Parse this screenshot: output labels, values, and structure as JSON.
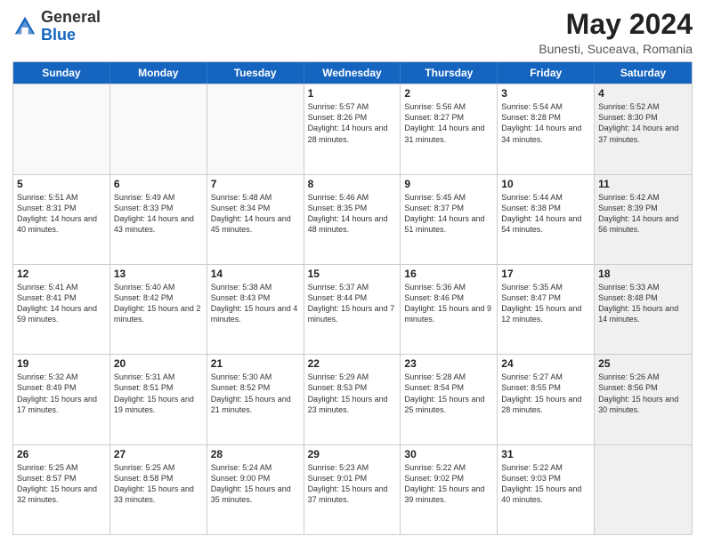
{
  "header": {
    "logo_general": "General",
    "logo_blue": "Blue",
    "month_title": "May 2024",
    "location": "Bunesti, Suceava, Romania"
  },
  "days_of_week": [
    "Sunday",
    "Monday",
    "Tuesday",
    "Wednesday",
    "Thursday",
    "Friday",
    "Saturday"
  ],
  "weeks": [
    [
      {
        "day": "",
        "info": "",
        "shaded": false,
        "empty": true
      },
      {
        "day": "",
        "info": "",
        "shaded": false,
        "empty": true
      },
      {
        "day": "",
        "info": "",
        "shaded": false,
        "empty": true
      },
      {
        "day": "1",
        "info": "Sunrise: 5:57 AM\nSunset: 8:26 PM\nDaylight: 14 hours\nand 28 minutes.",
        "shaded": false,
        "empty": false
      },
      {
        "day": "2",
        "info": "Sunrise: 5:56 AM\nSunset: 8:27 PM\nDaylight: 14 hours\nand 31 minutes.",
        "shaded": false,
        "empty": false
      },
      {
        "day": "3",
        "info": "Sunrise: 5:54 AM\nSunset: 8:28 PM\nDaylight: 14 hours\nand 34 minutes.",
        "shaded": false,
        "empty": false
      },
      {
        "day": "4",
        "info": "Sunrise: 5:52 AM\nSunset: 8:30 PM\nDaylight: 14 hours\nand 37 minutes.",
        "shaded": true,
        "empty": false
      }
    ],
    [
      {
        "day": "5",
        "info": "Sunrise: 5:51 AM\nSunset: 8:31 PM\nDaylight: 14 hours\nand 40 minutes.",
        "shaded": false,
        "empty": false
      },
      {
        "day": "6",
        "info": "Sunrise: 5:49 AM\nSunset: 8:33 PM\nDaylight: 14 hours\nand 43 minutes.",
        "shaded": false,
        "empty": false
      },
      {
        "day": "7",
        "info": "Sunrise: 5:48 AM\nSunset: 8:34 PM\nDaylight: 14 hours\nand 45 minutes.",
        "shaded": false,
        "empty": false
      },
      {
        "day": "8",
        "info": "Sunrise: 5:46 AM\nSunset: 8:35 PM\nDaylight: 14 hours\nand 48 minutes.",
        "shaded": false,
        "empty": false
      },
      {
        "day": "9",
        "info": "Sunrise: 5:45 AM\nSunset: 8:37 PM\nDaylight: 14 hours\nand 51 minutes.",
        "shaded": false,
        "empty": false
      },
      {
        "day": "10",
        "info": "Sunrise: 5:44 AM\nSunset: 8:38 PM\nDaylight: 14 hours\nand 54 minutes.",
        "shaded": false,
        "empty": false
      },
      {
        "day": "11",
        "info": "Sunrise: 5:42 AM\nSunset: 8:39 PM\nDaylight: 14 hours\nand 56 minutes.",
        "shaded": true,
        "empty": false
      }
    ],
    [
      {
        "day": "12",
        "info": "Sunrise: 5:41 AM\nSunset: 8:41 PM\nDaylight: 14 hours\nand 59 minutes.",
        "shaded": false,
        "empty": false
      },
      {
        "day": "13",
        "info": "Sunrise: 5:40 AM\nSunset: 8:42 PM\nDaylight: 15 hours\nand 2 minutes.",
        "shaded": false,
        "empty": false
      },
      {
        "day": "14",
        "info": "Sunrise: 5:38 AM\nSunset: 8:43 PM\nDaylight: 15 hours\nand 4 minutes.",
        "shaded": false,
        "empty": false
      },
      {
        "day": "15",
        "info": "Sunrise: 5:37 AM\nSunset: 8:44 PM\nDaylight: 15 hours\nand 7 minutes.",
        "shaded": false,
        "empty": false
      },
      {
        "day": "16",
        "info": "Sunrise: 5:36 AM\nSunset: 8:46 PM\nDaylight: 15 hours\nand 9 minutes.",
        "shaded": false,
        "empty": false
      },
      {
        "day": "17",
        "info": "Sunrise: 5:35 AM\nSunset: 8:47 PM\nDaylight: 15 hours\nand 12 minutes.",
        "shaded": false,
        "empty": false
      },
      {
        "day": "18",
        "info": "Sunrise: 5:33 AM\nSunset: 8:48 PM\nDaylight: 15 hours\nand 14 minutes.",
        "shaded": true,
        "empty": false
      }
    ],
    [
      {
        "day": "19",
        "info": "Sunrise: 5:32 AM\nSunset: 8:49 PM\nDaylight: 15 hours\nand 17 minutes.",
        "shaded": false,
        "empty": false
      },
      {
        "day": "20",
        "info": "Sunrise: 5:31 AM\nSunset: 8:51 PM\nDaylight: 15 hours\nand 19 minutes.",
        "shaded": false,
        "empty": false
      },
      {
        "day": "21",
        "info": "Sunrise: 5:30 AM\nSunset: 8:52 PM\nDaylight: 15 hours\nand 21 minutes.",
        "shaded": false,
        "empty": false
      },
      {
        "day": "22",
        "info": "Sunrise: 5:29 AM\nSunset: 8:53 PM\nDaylight: 15 hours\nand 23 minutes.",
        "shaded": false,
        "empty": false
      },
      {
        "day": "23",
        "info": "Sunrise: 5:28 AM\nSunset: 8:54 PM\nDaylight: 15 hours\nand 25 minutes.",
        "shaded": false,
        "empty": false
      },
      {
        "day": "24",
        "info": "Sunrise: 5:27 AM\nSunset: 8:55 PM\nDaylight: 15 hours\nand 28 minutes.",
        "shaded": false,
        "empty": false
      },
      {
        "day": "25",
        "info": "Sunrise: 5:26 AM\nSunset: 8:56 PM\nDaylight: 15 hours\nand 30 minutes.",
        "shaded": true,
        "empty": false
      }
    ],
    [
      {
        "day": "26",
        "info": "Sunrise: 5:25 AM\nSunset: 8:57 PM\nDaylight: 15 hours\nand 32 minutes.",
        "shaded": false,
        "empty": false
      },
      {
        "day": "27",
        "info": "Sunrise: 5:25 AM\nSunset: 8:58 PM\nDaylight: 15 hours\nand 33 minutes.",
        "shaded": false,
        "empty": false
      },
      {
        "day": "28",
        "info": "Sunrise: 5:24 AM\nSunset: 9:00 PM\nDaylight: 15 hours\nand 35 minutes.",
        "shaded": false,
        "empty": false
      },
      {
        "day": "29",
        "info": "Sunrise: 5:23 AM\nSunset: 9:01 PM\nDaylight: 15 hours\nand 37 minutes.",
        "shaded": false,
        "empty": false
      },
      {
        "day": "30",
        "info": "Sunrise: 5:22 AM\nSunset: 9:02 PM\nDaylight: 15 hours\nand 39 minutes.",
        "shaded": false,
        "empty": false
      },
      {
        "day": "31",
        "info": "Sunrise: 5:22 AM\nSunset: 9:03 PM\nDaylight: 15 hours\nand 40 minutes.",
        "shaded": false,
        "empty": false
      },
      {
        "day": "",
        "info": "",
        "shaded": true,
        "empty": true
      }
    ]
  ]
}
